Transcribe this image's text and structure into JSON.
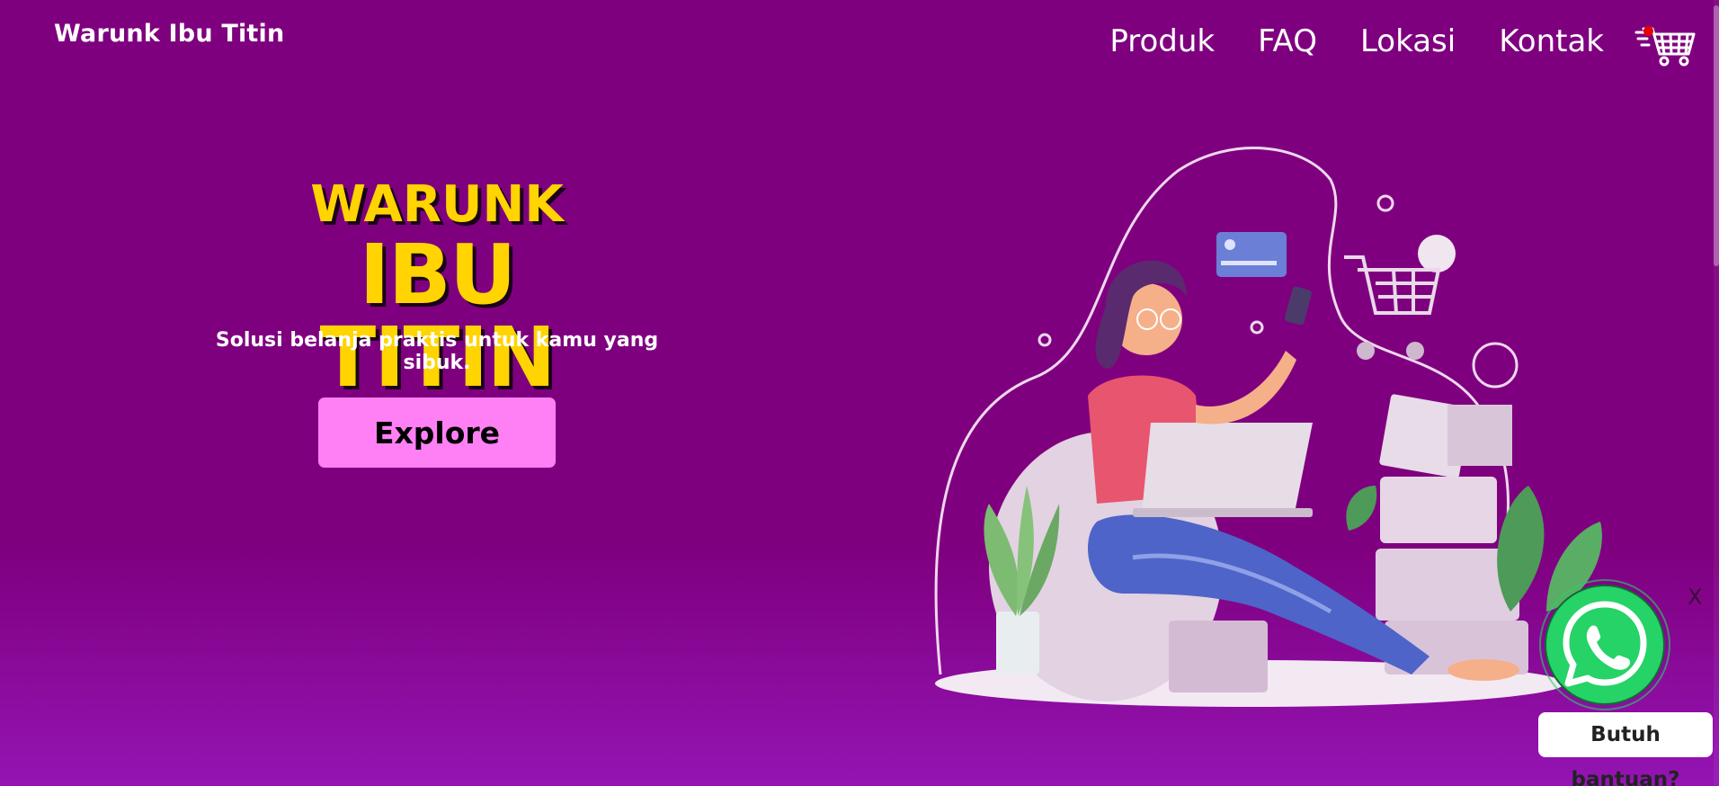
{
  "brand": "Warunk Ibu Titin",
  "nav": {
    "items": [
      "Produk",
      "FAQ",
      "Lokasi",
      "Kontak"
    ]
  },
  "cart": {
    "icon": "cart-icon",
    "badge_color": "#e60000"
  },
  "hero": {
    "title_small": "WARUNK",
    "title_big": "IBU TITIN",
    "tagline": "Solusi belanja praktis untuk kamu yang sibuk.",
    "cta_label": "Explore"
  },
  "whatsapp": {
    "close_label": "X",
    "icon": "whatsapp-icon",
    "help_label": "Butuh bantuan?"
  },
  "colors": {
    "background": "#7f007f",
    "title": "#ffd400",
    "cta": "#ff80f5",
    "whatsapp": "#25d366"
  }
}
